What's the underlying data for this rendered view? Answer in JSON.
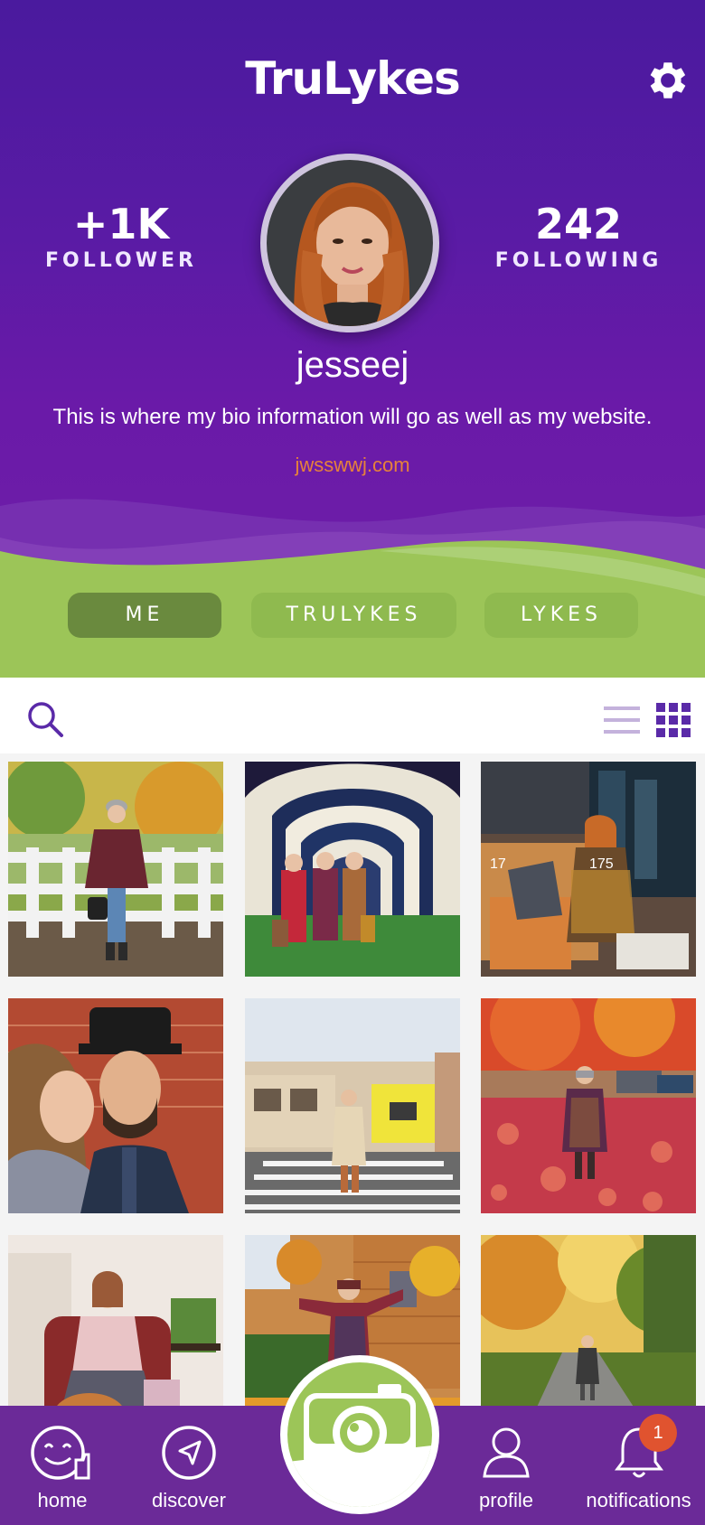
{
  "header": {
    "app_title": "TruLykes",
    "followers": {
      "value": "+1K",
      "label": "FOLLOWER"
    },
    "following": {
      "value": "242",
      "label": "FOLLOWING"
    },
    "username": "jesseej",
    "bio": "This is where my bio information will go as well as my website.",
    "website": "jwsswwj.com"
  },
  "tabs": [
    {
      "label": "ME",
      "active": true
    },
    {
      "label": "TRULYKES",
      "active": false
    },
    {
      "label": "LYKES",
      "active": false
    }
  ],
  "toolbar": {
    "search_icon": "search-icon",
    "view_modes": [
      "list-view-icon",
      "grid-view-icon"
    ],
    "active_view": "grid"
  },
  "photos": [
    {
      "name": "photo-bridge"
    },
    {
      "name": "photo-light-tunnel",
      "likes": "",
      "comments": ""
    },
    {
      "name": "photo-cafe",
      "likes": "175",
      "comments": "17"
    },
    {
      "name": "photo-couple"
    },
    {
      "name": "photo-crosswalk"
    },
    {
      "name": "photo-autumn-leaves"
    },
    {
      "name": "photo-armchair"
    },
    {
      "name": "photo-brick-street"
    },
    {
      "name": "photo-forest-path"
    }
  ],
  "nav": {
    "home": "home",
    "discover": "discover",
    "profile": "profile",
    "notifications": "notifications",
    "notification_count": "1"
  },
  "colors": {
    "header_purple": "#5a1ba5",
    "accent_green": "#9cc558",
    "tab_active": "#6a8a3e",
    "nav_purple": "#6b2a98",
    "badge_red": "#e0532f",
    "website_orange": "#e6823a"
  }
}
